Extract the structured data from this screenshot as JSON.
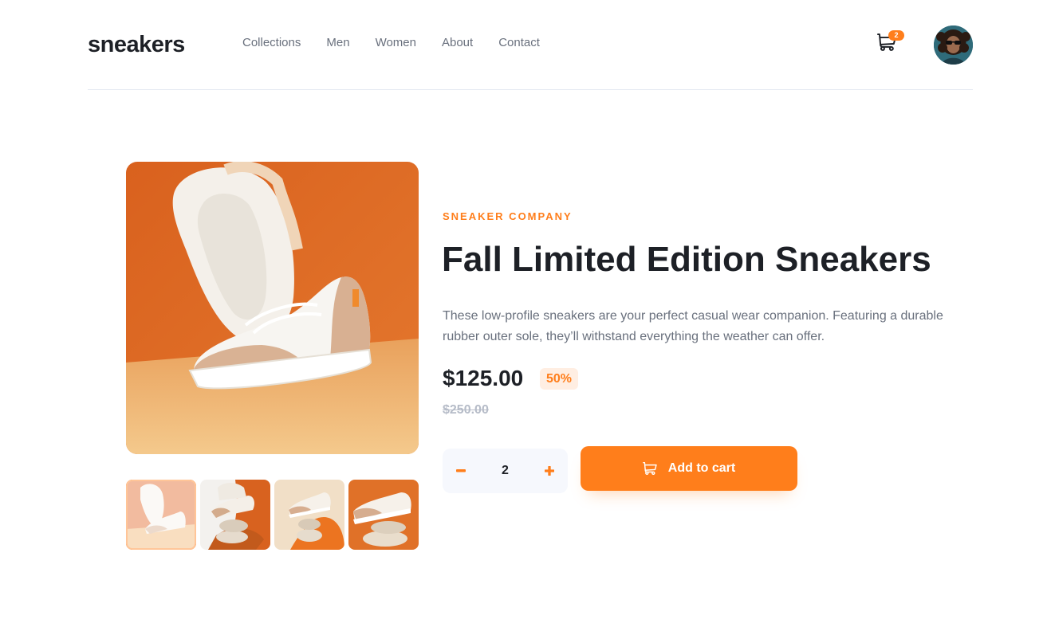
{
  "header": {
    "logo": "sneakers",
    "nav": [
      "Collections",
      "Men",
      "Women",
      "About",
      "Contact"
    ],
    "cart_count": "2",
    "cart_icon": "cart-icon",
    "avatar_icon": "avatar-image"
  },
  "gallery": {
    "main_image": "sneaker-hero-image",
    "thumbnails": [
      "thumb-1",
      "thumb-2",
      "thumb-3",
      "thumb-4"
    ],
    "active_thumbnail": 1
  },
  "product": {
    "company": "SNEAKER COMPANY",
    "title": "Fall Limited Edition Sneakers",
    "description": "These low-profile sneakers are your perfect casual wear companion. Featuring a durable rubber outer sole, they’ll withstand everything the weather can offer.",
    "price": "$125.00",
    "discount": "50%",
    "original_price": "$250.00"
  },
  "cart_controls": {
    "quantity": "2",
    "minus_icon": "minus-icon",
    "plus_icon": "plus-icon",
    "add_label": "Add to cart"
  },
  "colors": {
    "accent": "#ff7e1b",
    "accent_pale": "#ffeee2",
    "text_dark": "#1d2026",
    "text_gray": "#69707d",
    "text_light": "#b6bcc8"
  }
}
